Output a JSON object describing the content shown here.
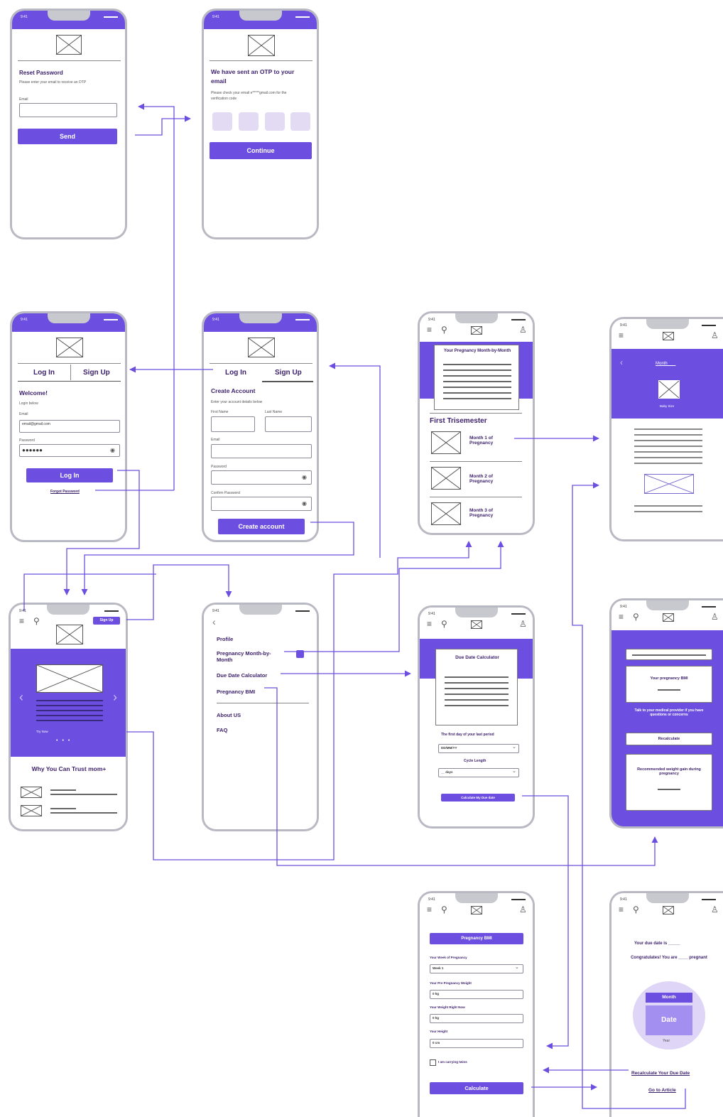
{
  "colors": {
    "accent": "#6c4fe0",
    "connector": "#6c4fe0",
    "frame": "#b9b9c4",
    "text": "#3b1f6b"
  },
  "reset": {
    "title": "Reset Password",
    "subtitle": "Please enter your email to receive an OTP",
    "email_label": "Email",
    "send": "Send"
  },
  "otp": {
    "title": "We have sent an OTP to your email",
    "subtitle": "Please check your email e*****gmail.com for the verification code",
    "continue": "Continue"
  },
  "login": {
    "tab_login": "Log In",
    "tab_signup": "Sign Up",
    "welcome": "Welcome!",
    "login_below": "Login below",
    "email_label": "Email",
    "email_value": "email@gmail.com",
    "password_label": "Password",
    "password_value": "●●●●●●",
    "login_button": "Log In",
    "forgot": "Forgot Password"
  },
  "signup": {
    "tab_login": "Log In",
    "tab_signup": "Sign Up",
    "title": "Create Account",
    "subtitle": "Enter your account details below",
    "first_name": "First Name",
    "last_name": "Last Name",
    "email": "Email",
    "password": "Password",
    "confirm": "Confirm Password",
    "create": "Create account"
  },
  "month_list": {
    "card_title": "Your Pregnancy Month-by-Month",
    "trimester": "First Trisemester",
    "items": [
      "Month 1 of Pregnancy",
      "Month 2 of Pregnancy",
      "Month 3 of Pregnancy"
    ]
  },
  "month_detail": {
    "title": "Month ___",
    "caption": "Baby Size"
  },
  "home": {
    "signup_chip": "Sign Up",
    "try_now": "Try Now",
    "trust_title": "Why You Can Trust mom+"
  },
  "menu": {
    "items": [
      "Profile",
      "Pregnancy Month-by-Month",
      "Due Date Calculator",
      "Pregnancy BMI",
      "About US",
      "FAQ"
    ]
  },
  "due_calc": {
    "card_title": "Due Date Calculator",
    "period_label": "The first day of your last period",
    "period_value": "DD/MM/YY",
    "cycle_label": "Cycle Length",
    "cycle_value": "__ days",
    "calc_button": "Calculate My Due date"
  },
  "bmi_result": {
    "bmi_title": "Your pregnancy BMI",
    "talk": "Talk to your medical provider if you have questions or concerns",
    "recalc": "Recalculate",
    "weight_gain": "Recommended weight gain during pregnancy"
  },
  "bmi_form": {
    "title": "Pregnancy BMI",
    "week_label": "Your Week of Pregnancy",
    "week_value": "Week 1",
    "pre_label": "Your Pre Pregnancy Weight",
    "pre_value": "0 kg",
    "now_label": "Your Weight Right Now",
    "now_value": "0 kg",
    "height_label": "Your Height",
    "height_value": "0 cm",
    "twins": "I am carrying twins",
    "calc": "Calculate"
  },
  "due_result": {
    "due_text": "Your due date is _____",
    "congrats": "Congratulates! You are ____ pregnant",
    "month": "Month",
    "date": "Date",
    "year": "Year",
    "recalc_link": "Recalculate Your Due Date",
    "article_link": "Go to Article"
  }
}
